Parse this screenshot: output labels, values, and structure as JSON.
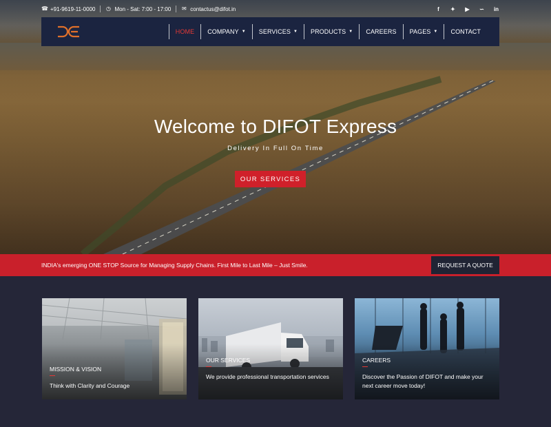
{
  "topbar": {
    "phone": "+91-9619-11-0000",
    "hours": "Mon - Sat: 7:00 - 17:00",
    "email": "contactus@difot.in",
    "social": [
      "f",
      "t",
      "yt",
      "rss",
      "in"
    ]
  },
  "nav": {
    "items": [
      {
        "label": "HOME",
        "caret": false
      },
      {
        "label": "COMPANY",
        "caret": true
      },
      {
        "label": "SERVICES",
        "caret": true
      },
      {
        "label": "PRODUCTS",
        "caret": true
      },
      {
        "label": "CAREERS",
        "caret": false
      },
      {
        "label": "PAGES",
        "caret": true
      },
      {
        "label": "CONTACT",
        "caret": false
      }
    ],
    "active_color": "#e53935"
  },
  "hero": {
    "title": "Welcome to DIFOT Express",
    "subtitle": "Delivery In Full On Time",
    "button": "OUR SERVICES"
  },
  "strip": {
    "message": "INDIA's emerging ONE STOP Source for Managing Supply Chains. First Mile to Last Mile – Just Smile.",
    "button": "REQUEST A QUOTE"
  },
  "cards": [
    {
      "title": "MISSION & VISION",
      "desc": "Think with Clarity and Courage"
    },
    {
      "title": "OUR SERVICES",
      "desc": "We provide professional transportation services"
    },
    {
      "title": "CAREERS",
      "desc": "Discover the Passion of DIFOT and make your next career move today!"
    }
  ],
  "colors": {
    "brand_red": "#c9202b",
    "nav_bg": "#1b2440",
    "page_bg": "#252638",
    "logo_orange": "#e0702a"
  }
}
